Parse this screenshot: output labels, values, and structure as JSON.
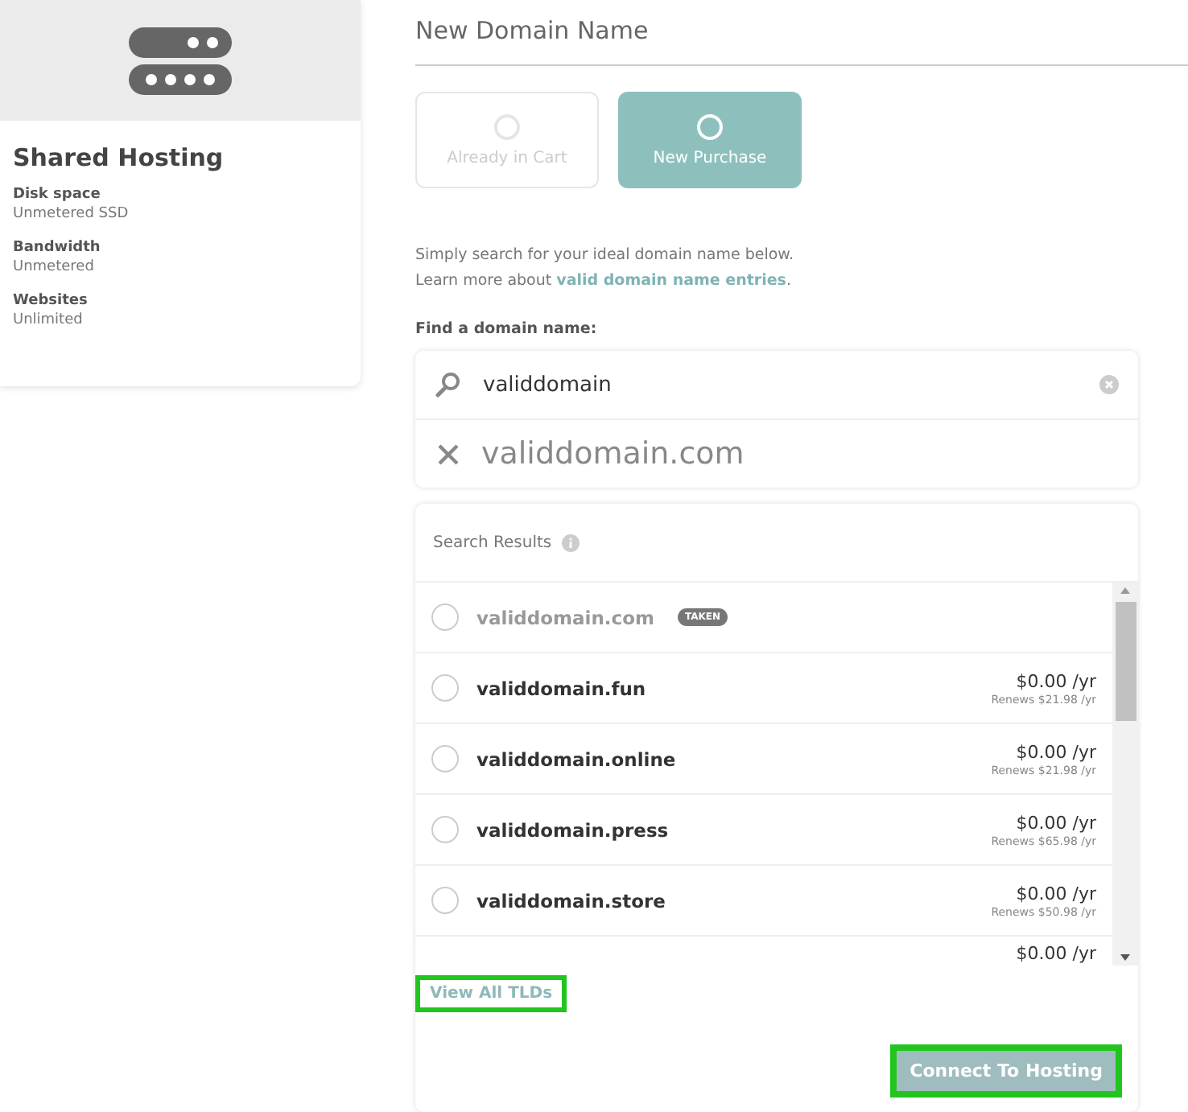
{
  "plan_card": {
    "title": "Shared Hosting",
    "specs": [
      {
        "label": "Disk space",
        "value": "Unmetered SSD"
      },
      {
        "label": "Bandwidth",
        "value": "Unmetered"
      },
      {
        "label": "Websites",
        "value": "Unlimited"
      }
    ]
  },
  "section_title": "New Domain Name",
  "options": [
    {
      "label": "Already in Cart",
      "selected": false
    },
    {
      "label": "New Purchase",
      "selected": true
    }
  ],
  "intro": {
    "line_1": "Simply search for your ideal domain name below.",
    "line_2_prefix": "Learn more about ",
    "link": "valid domain name entries",
    "line_2_suffix": "."
  },
  "search": {
    "label": "Find a domain name:",
    "value": "validdomain",
    "suggestion": "validdomain.com"
  },
  "results": {
    "title": "Search Results",
    "rows": [
      {
        "kind": "taken",
        "domain": "validdomain.com",
        "badge": "TAKEN",
        "selected": false
      },
      {
        "kind": "available",
        "domain": "validdomain.fun",
        "price": "$0.00 /yr",
        "renews": "Renews $21.98 /yr",
        "selected": false
      },
      {
        "kind": "available",
        "domain": "validdomain.online",
        "price": "$0.00 /yr",
        "renews": "Renews $21.98 /yr",
        "selected": false
      },
      {
        "kind": "available",
        "domain": "validdomain.press",
        "price": "$0.00 /yr",
        "renews": "Renews $65.98 /yr",
        "selected": false
      },
      {
        "kind": "available",
        "domain": "validdomain.store",
        "price": "$0.00 /yr",
        "renews": "Renews $50.98 /yr",
        "selected": false
      },
      {
        "kind": "partial",
        "price": "$0.00 /yr"
      }
    ],
    "view_all": {
      "label": "View All TLDs",
      "highlighted": true
    },
    "connect": {
      "label": "Connect To Hosting",
      "highlighted": true
    }
  }
}
